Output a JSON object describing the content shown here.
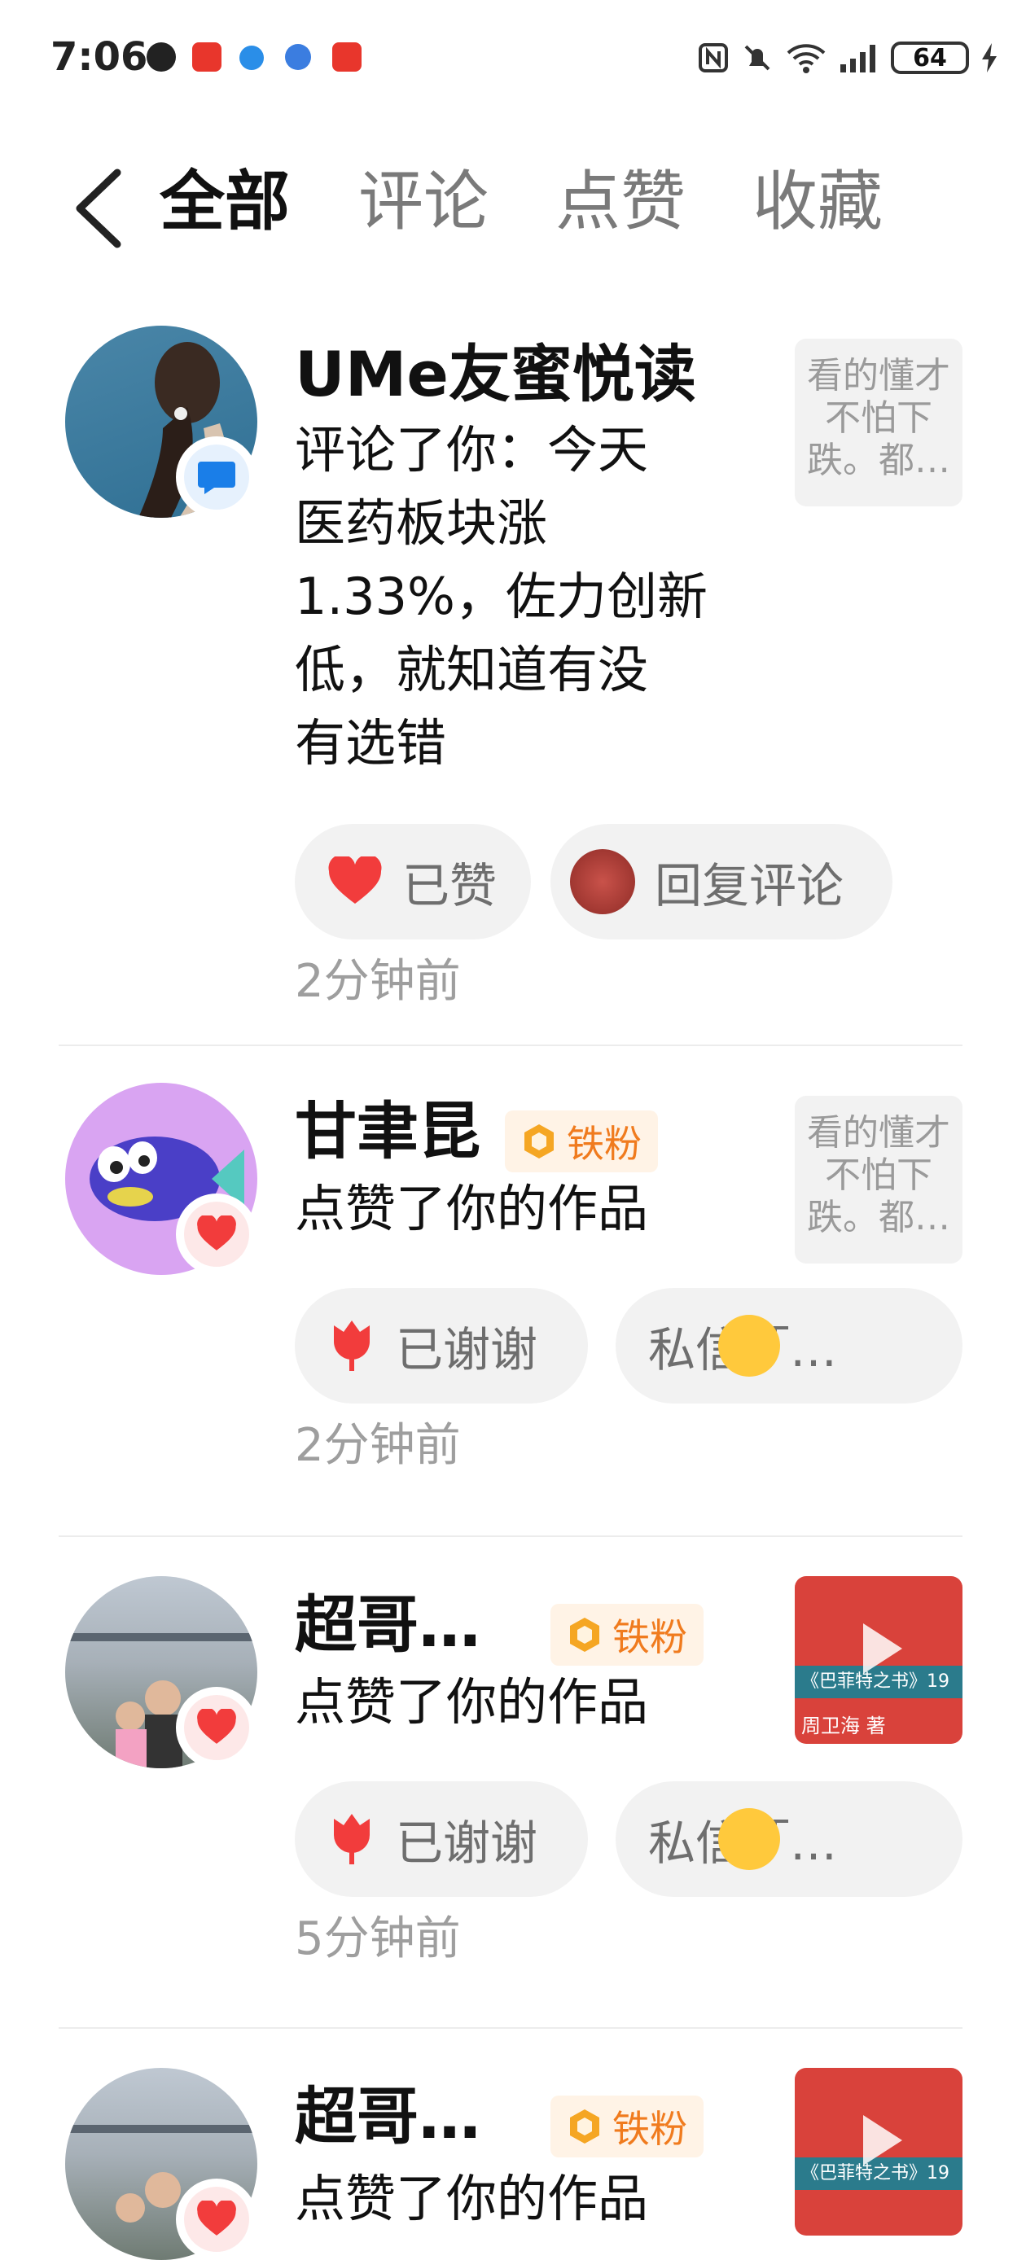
{
  "status_bar": {
    "time": "7:06",
    "battery": "64"
  },
  "tabs": [
    "全部",
    "评论",
    "点赞",
    "收藏"
  ],
  "notifications": [
    {
      "name": "UMe友蜜悦读",
      "action_lines": [
        "评论了你：今天",
        "医药板块涨",
        "1.33%，佐力创新",
        "低，就知道有没",
        "有选错"
      ],
      "thumb_text": "看的懂才不怕下跌。都…",
      "buttons": [
        "已赞",
        "回复评论"
      ],
      "time_ago": "2分钟前",
      "badge": "comment"
    },
    {
      "name": "甘聿昆",
      "fan_label": "铁粉",
      "action": "点赞了你的作品",
      "thumb_text": "看的懂才不怕下跌。都…",
      "buttons": [
        "已谢谢",
        "私信「…"
      ],
      "time_ago": "2分钟前",
      "badge": "heart"
    },
    {
      "name": "超哥…",
      "fan_label": "铁粉",
      "action": "点赞了你的作品",
      "thumb_caption": "周卫海  著",
      "thumb_title": "《巴菲特之书》19",
      "buttons": [
        "已谢谢",
        "私信「…"
      ],
      "time_ago": "5分钟前",
      "badge": "heart"
    },
    {
      "name": "超哥…",
      "fan_label": "铁粉",
      "action": "点赞了你的作品",
      "thumb_title": "《巴菲特之书》19",
      "badge": "heart"
    }
  ]
}
